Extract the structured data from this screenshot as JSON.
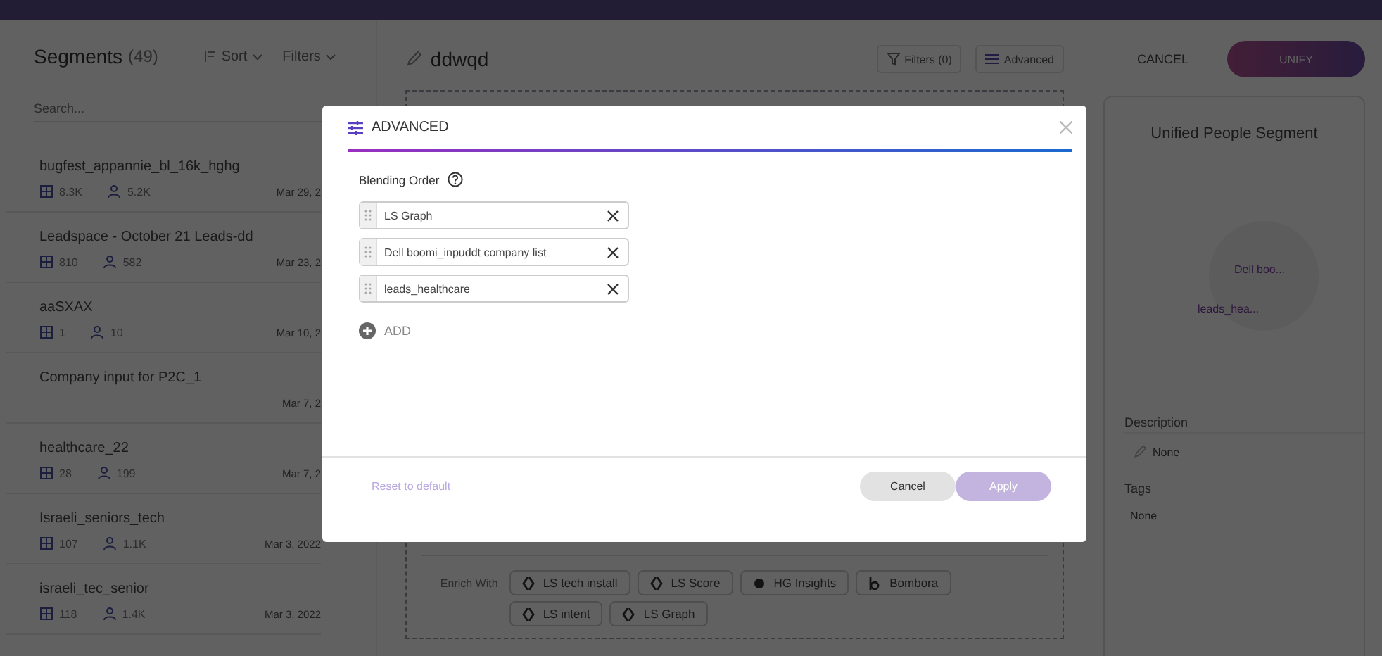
{
  "segments_panel": {
    "title": "Segments",
    "count": "(49)",
    "sort": "Sort",
    "filters": "Filters",
    "search": {
      "placeholder": "Search..."
    },
    "items": [
      {
        "name": "bugfest_appannie_bl_16k_hghg",
        "companies": "8.3K",
        "people": "5.2K",
        "date": "Mar 29, 2"
      },
      {
        "name": "Leadspace - October 21 Leads-dd",
        "companies": "810",
        "people": "582",
        "date": "Mar 23, 2"
      },
      {
        "name": "aaSXAX",
        "companies": "1",
        "people": "10",
        "date": "Mar 10, 2"
      },
      {
        "name": "Company input for P2C_1",
        "date": "Mar 7, 2"
      },
      {
        "name": "healthcare_22",
        "companies": "28",
        "people": "199",
        "date": "Mar 7, 2"
      },
      {
        "name": "Israeli_seniors_tech",
        "companies": "107",
        "people": "1.1K",
        "date": "Mar 3, 2022"
      },
      {
        "name": "israeli_tec_senior",
        "companies": "118",
        "people": "1.4K",
        "date": "Mar 3, 2022"
      }
    ]
  },
  "editor": {
    "title": "ddwqd",
    "filters_button": "Filters (0)",
    "advanced_button": "Advanced",
    "enrich_label": "Enrich With",
    "enrich_chips": [
      {
        "label": "LS tech install",
        "kind": "leadspace"
      },
      {
        "label": "LS Score",
        "kind": "leadspace"
      },
      {
        "label": "HG Insights",
        "kind": "hg"
      },
      {
        "label": "Bombora",
        "kind": "bombora"
      },
      {
        "label": "LS intent",
        "kind": "leadspace"
      },
      {
        "label": "LS Graph",
        "kind": "leadspace"
      }
    ]
  },
  "actions": {
    "cancel": "CANCEL",
    "unify": "UNIFY"
  },
  "summary": {
    "title": "Unified People Segment",
    "venn_labels": [
      "Dell boo...",
      "leads_hea..."
    ],
    "description_label": "Description",
    "description_value": "None",
    "tags_label": "Tags",
    "tags_value": "None"
  },
  "dialog": {
    "title": "ADVANCED",
    "blending_label": "Blending Order",
    "blending_items": [
      "LS Graph",
      "Dell boomi_inpuddt company list",
      "leads_healthcare"
    ],
    "add": "ADD",
    "reset": "Reset to default",
    "cancel": "Cancel",
    "apply": "Apply"
  }
}
